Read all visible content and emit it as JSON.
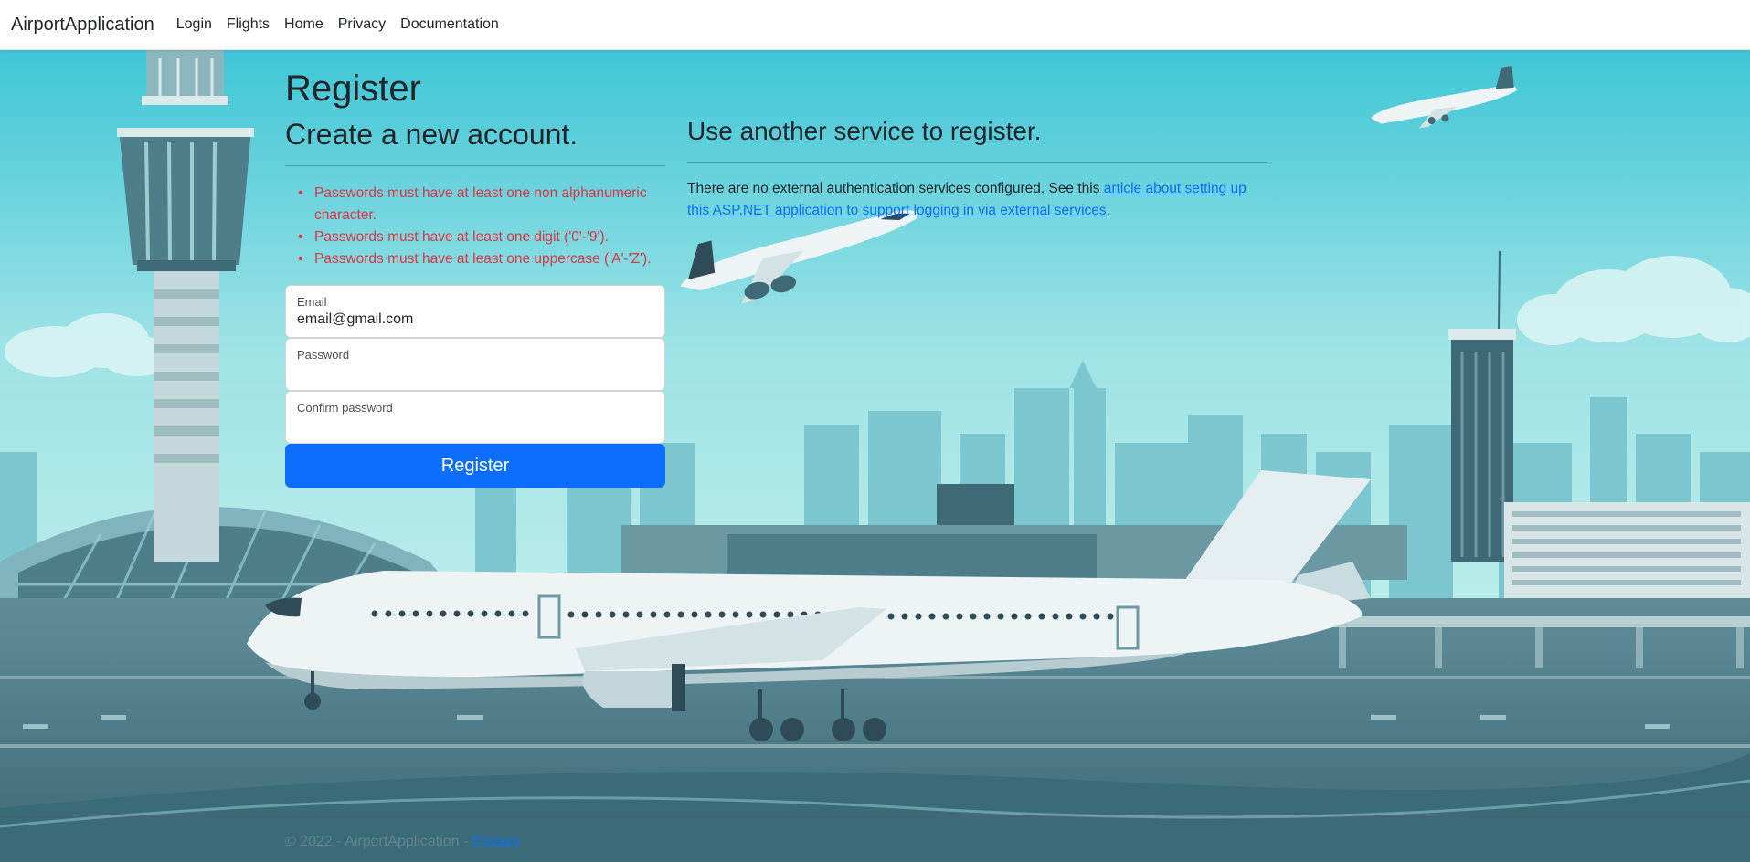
{
  "nav": {
    "brand": "AirportApplication",
    "links": [
      "Login",
      "Flights",
      "Home",
      "Privacy",
      "Documentation"
    ]
  },
  "register": {
    "title": "Register",
    "subtitle": "Create a new account.",
    "errors": [
      "Passwords must have at least one non alphanumeric character.",
      "Passwords must have at least one digit ('0'-'9').",
      "Passwords must have at least one uppercase ('A'-'Z')."
    ],
    "email_label": "Email",
    "email_value": "email@gmail.com",
    "password_label": "Password",
    "password_value": "",
    "confirm_label": "Confirm password",
    "confirm_value": "",
    "submit_label": "Register"
  },
  "external": {
    "title": "Use another service to register.",
    "text": "There are no external authentication services configured. See this ",
    "link_text": "article about setting up this ASP.NET application to support logging in via external services",
    "text_end": "."
  },
  "footer": {
    "text": "© 2022 - AirportApplication - ",
    "privacy_link": "Privacy"
  },
  "colors": {
    "primary": "#0d6efd",
    "danger": "#dc3545",
    "sky": "#5ccfd9"
  }
}
